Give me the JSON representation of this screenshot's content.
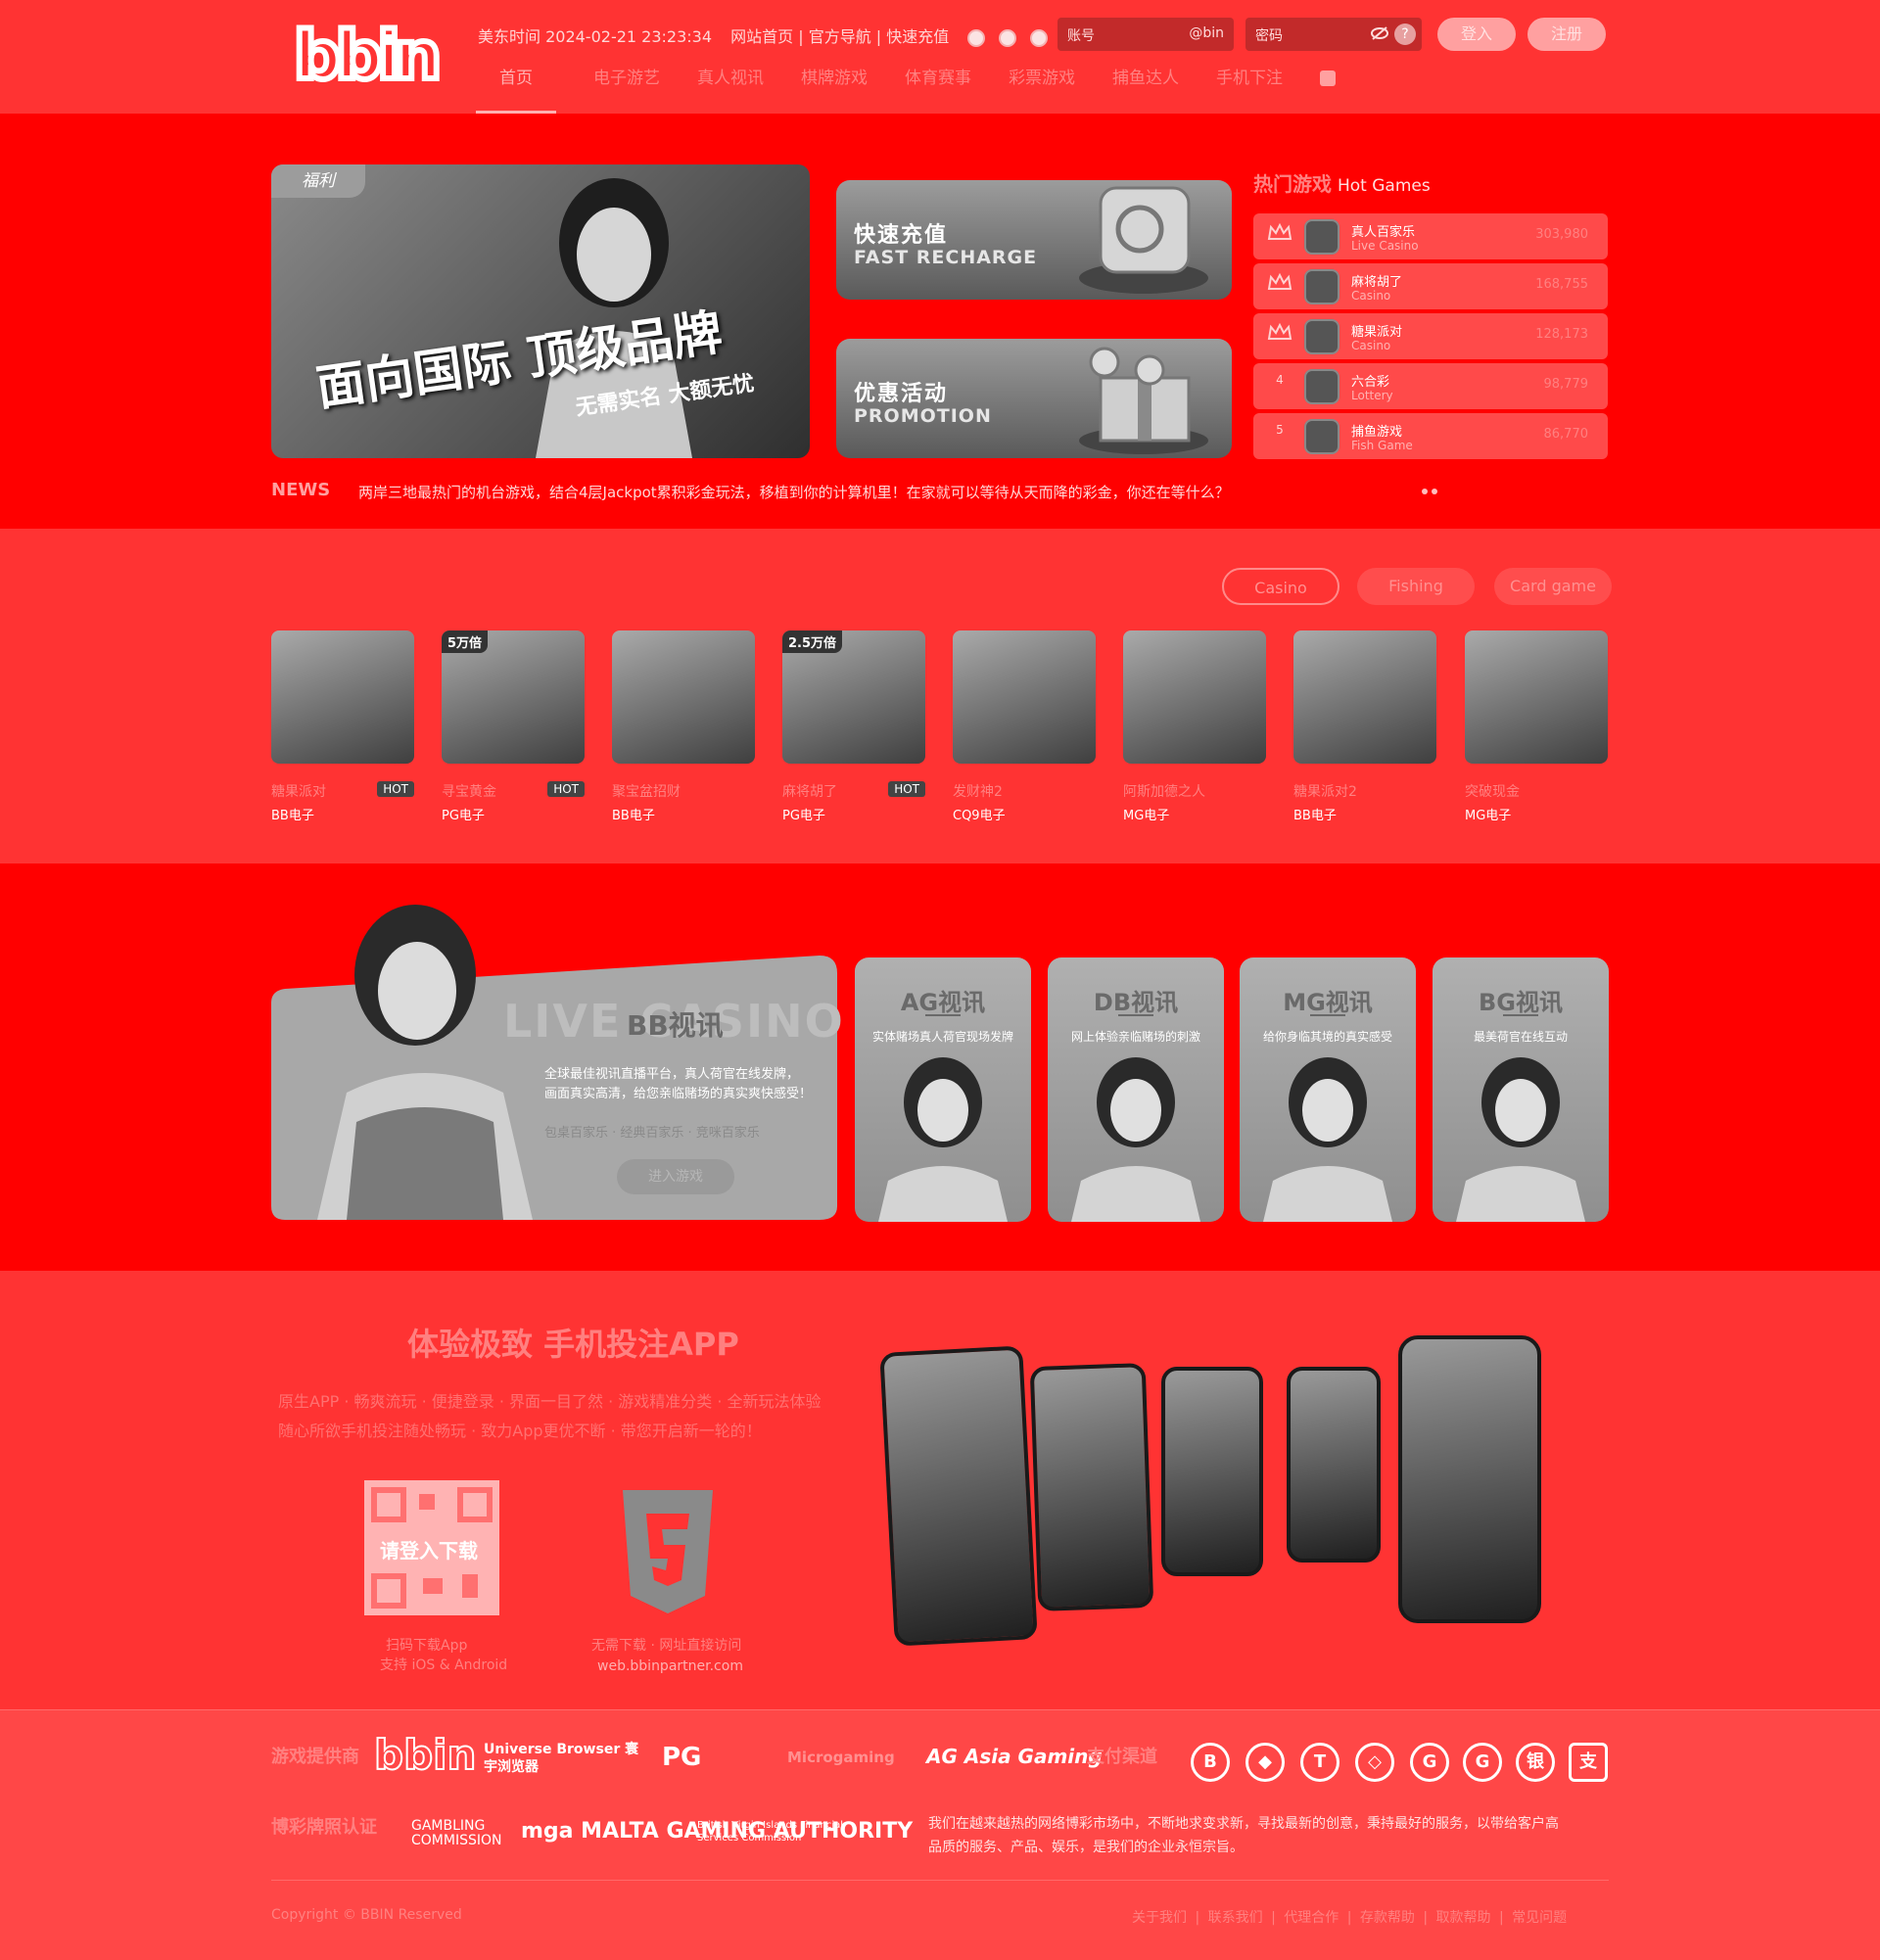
{
  "header": {
    "logo_text": "bbin",
    "time_label": "美东时间 2024-02-21 23:23:34",
    "links": "网站首页 | 官方导航 | 快速充值",
    "account_placeholder": "账号",
    "account_suffix": "@bin",
    "password_placeholder": "密码",
    "help_icon": "?",
    "login_label": "登入",
    "register_label": "注册",
    "nav": [
      "首页",
      "电子游艺",
      "真人视讯",
      "棋牌游戏",
      "体育赛事",
      "彩票游戏",
      "捕鱼达人",
      "手机下注"
    ]
  },
  "banner": {
    "tag": "福利",
    "title": "面向国际 顶级品牌",
    "subtitle": "无需实名 大额无忧",
    "recharge_cn": "快速充值",
    "recharge_en": "FAST RECHARGE",
    "promo_cn": "优惠活动",
    "promo_en": "PROMOTION"
  },
  "hot_games": {
    "title_cn": "热门游戏",
    "title_en": "Hot Games",
    "items": [
      {
        "rank": "1",
        "name": "真人百家乐",
        "cat": "Live Casino",
        "count": "303,980"
      },
      {
        "rank": "2",
        "name": "麻将胡了",
        "cat": "Casino",
        "count": "168,755"
      },
      {
        "rank": "3",
        "name": "糖果派对",
        "cat": "Casino",
        "count": "128,173"
      },
      {
        "rank": "4",
        "name": "六合彩",
        "cat": "Lottery",
        "count": "98,779"
      },
      {
        "rank": "5",
        "name": "捕鱼游戏",
        "cat": "Fish Game",
        "count": "86,770"
      }
    ]
  },
  "news": {
    "label": "NEWS",
    "text": "两岸三地最热门的机台游戏，结合4层Jackpot累积彩金玩法，移植到你的计算机里！在家就可以等待从天而降的彩金，你还在等什么？"
  },
  "game_tabs": [
    "Casino",
    "Fishing",
    "Card game"
  ],
  "games": [
    {
      "badge": "",
      "name": "糖果派对",
      "hot": "HOT",
      "provider": "BB电子"
    },
    {
      "badge": "5万倍",
      "name": "寻宝黄金",
      "hot": "HOT",
      "provider": "PG电子"
    },
    {
      "badge": "",
      "name": "聚宝盆招财",
      "hot": "",
      "provider": "BB电子"
    },
    {
      "badge": "2.5万倍",
      "name": "麻将胡了",
      "hot": "HOT",
      "provider": "PG电子"
    },
    {
      "badge": "",
      "name": "发财神2",
      "hot": "",
      "provider": "CQ9电子"
    },
    {
      "badge": "",
      "name": "阿斯加德之人",
      "hot": "",
      "provider": "MG电子"
    },
    {
      "badge": "",
      "name": "糖果派对2",
      "hot": "",
      "provider": "BB电子"
    },
    {
      "badge": "",
      "name": "突破现金",
      "hot": "",
      "provider": "MG电子"
    }
  ],
  "live": {
    "bg_text": "LIVE CASINO",
    "title": "BB视讯",
    "desc1": "全球最佳视讯直播平台，真人荷官在线发牌，",
    "desc2": "画面真实高清，给您亲临赌场的真实爽快感受！",
    "games": "包桌百家乐 · 经典百家乐 · 竞咪百家乐",
    "enter": "进入游戏",
    "vendors": [
      {
        "name": "AG视讯",
        "desc": "实体赌场真人荷官现场发牌"
      },
      {
        "name": "DB视讯",
        "desc": "网上体验亲临赌场的刺激"
      },
      {
        "name": "MG视讯",
        "desc": "给你身临其境的真实感受"
      },
      {
        "name": "BG视讯",
        "desc": "最美荷官在线互动"
      }
    ]
  },
  "app": {
    "title": "体验极致 手机投注APP",
    "desc1": "原生APP · 畅爽流玩 · 便捷登录 · 界面一目了然 · 游戏精准分类 · 全新玩法体验",
    "desc2": "随心所欲手机投注随处畅玩 · 致力App更优不断 · 带您开启新一轮的！",
    "qr_text": "请登入下载",
    "qr_cap1": "扫码下载App",
    "qr_cap2": "支持 iOS & Android",
    "h5_cap1": "无需下载 · 网址直接访问",
    "h5_url": "web.bbinpartner.com"
  },
  "footer": {
    "providers_label": "游戏提供商",
    "providers": [
      "bbin",
      "Universe Browser 寰宇浏览器",
      "PG",
      "Microgaming",
      "AG Asia Gaming"
    ],
    "payment_label": "支付渠道",
    "payments": [
      "B",
      "◆",
      "T",
      "◇",
      "G",
      "G",
      "银",
      "支"
    ],
    "license_label": "博彩牌照认证",
    "licenses": [
      "GAMBLING COMMISSION",
      "mga MALTA GAMING AUTHORITY",
      "British Virgin Islands Financial Services Commission"
    ],
    "desc1": "我们在越来越热的网络博彩市场中，不断地求变求新，寻找最新的创意，秉持最好的服务，以带给客户高",
    "desc2": "品质的服务、产品、娱乐，是我们的企业永恒宗旨。",
    "copyright": "Copyright © BBIN Reserved",
    "links": [
      "关于我们",
      "联系我们",
      "代理合作",
      "存款帮助",
      "取款帮助",
      "常见问题"
    ]
  }
}
